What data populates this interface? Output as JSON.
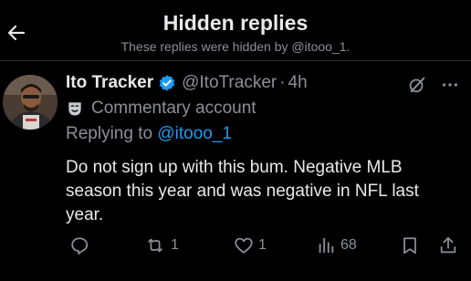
{
  "header": {
    "title": "Hidden replies",
    "subtitle": "These replies were hidden by @itooo_1."
  },
  "tweet": {
    "display_name": "Ito Tracker",
    "handle": "@ItoTracker",
    "separator": "·",
    "time": "4h",
    "label": "Commentary account",
    "replying_prefix": "Replying to ",
    "replying_to": "@itooo_1",
    "text": "Do not sign up with this bum. Negative MLB season this year and was negative in NFL last year.",
    "stats": {
      "replies": "",
      "reposts": "1",
      "likes": "1",
      "views": "68"
    }
  },
  "colors": {
    "background": "#000000",
    "text": "#e7e9ea",
    "secondary": "#8b9096",
    "accent": "#1d9bf0",
    "divider": "#2f3336"
  },
  "icons": {
    "back": "arrow-left-icon",
    "verified": "verified-badge-icon",
    "grok": "grok-icon",
    "more": "more-options-icon",
    "commentary": "theater-masks-icon",
    "reply": "reply-icon",
    "repost": "repost-icon",
    "like": "heart-icon",
    "views": "analytics-icon",
    "bookmark": "bookmark-icon",
    "share": "share-icon"
  }
}
